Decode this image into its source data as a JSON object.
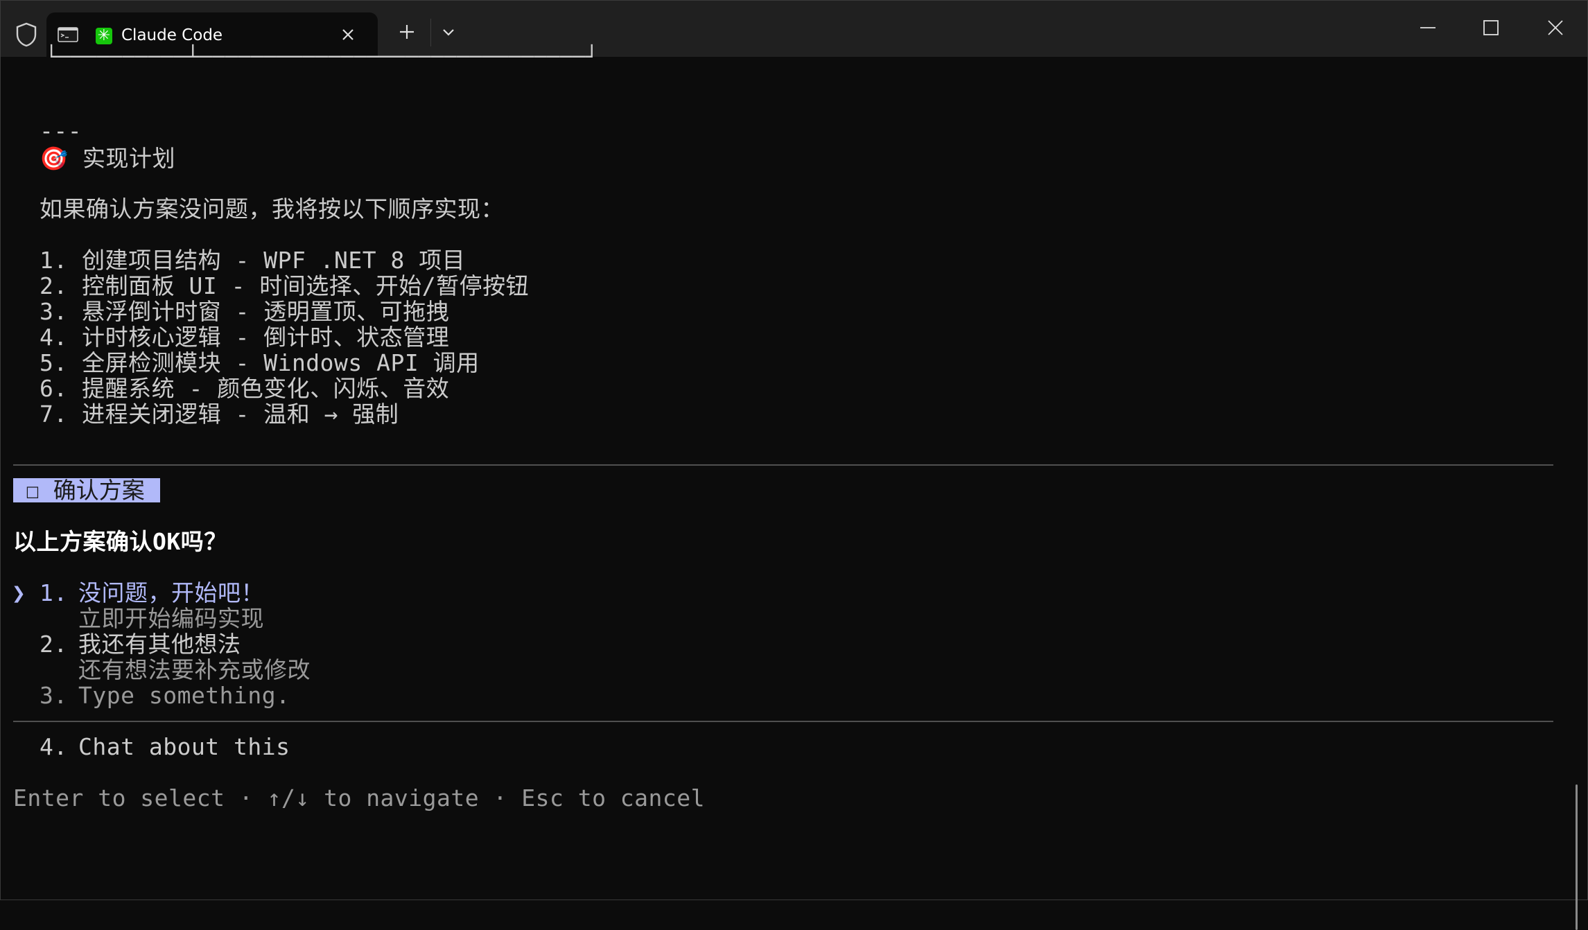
{
  "titlebar": {
    "tab_title": "Claude Code",
    "app_icon_glyph": "✳",
    "icons": {
      "shield": "shield-icon",
      "terminal": "terminal-icon",
      "close": "close-icon",
      "new_tab": "plus-icon",
      "dropdown": "chevron-down-icon",
      "minimize": "minimize-icon",
      "maximize": "maximize-icon",
      "window_close": "close-icon"
    }
  },
  "colors": {
    "background": "#0c0c0c",
    "titlebar": "#202020",
    "text": "#cccccc",
    "accent": "#b1b9f9",
    "app_icon": "#16c60c"
  },
  "terminal": {
    "box_fragment": "└──────────┴──────────────────────────────┘",
    "separator_dashes": "---",
    "plan_heading": "🎯 实现计划",
    "intro": "如果确认方案没问题，我将按以下顺序实现：",
    "steps": [
      "1. 创建项目结构 - WPF .NET 8 项目",
      "2. 控制面板 UI - 时间选择、开始/暂停按钮",
      "3. 悬浮倒计时窗 - 透明置顶、可拖拽",
      "4. 计时核心逻辑 - 倒计时、状态管理",
      "5. 全屏检测模块 - Windows API 调用",
      "6. 提醒系统 - 颜色变化、闪烁、音效",
      "7. 进程关闭逻辑 - 温和 → 强制"
    ]
  },
  "prompt": {
    "badge": "☐ 确认方案",
    "question": "以上方案确认OK吗？",
    "cursor": "❯",
    "options": [
      {
        "number": "1.",
        "label": "没问题，开始吧！",
        "description": "立即开始编码实现"
      },
      {
        "number": "2.",
        "label": "我还有其他想法",
        "description": "还有想法要补充或修改"
      },
      {
        "number": "3.",
        "label": "Type something."
      }
    ],
    "extra_option": {
      "number": "4.",
      "label": "Chat about this"
    },
    "footer": "Enter to select · ↑/↓ to navigate · Esc to cancel"
  }
}
